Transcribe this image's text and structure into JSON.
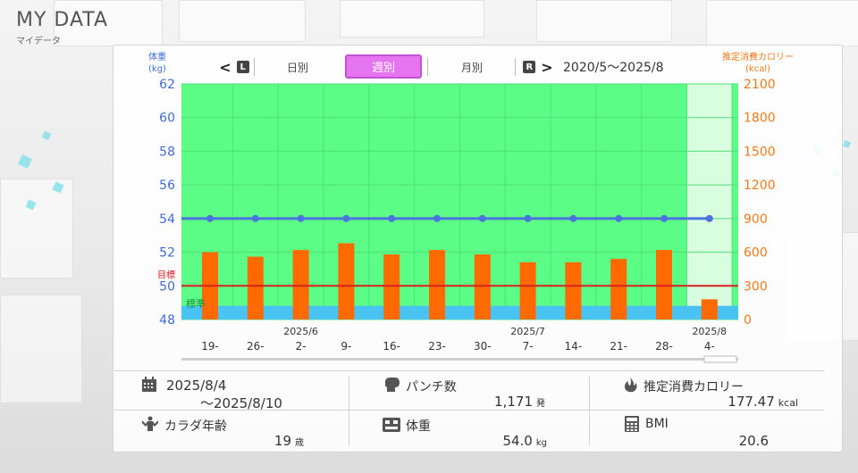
{
  "header": {
    "title": "MY DATA",
    "subtitle": "マイデータ"
  },
  "nav": {
    "prev_key": "L",
    "next_key": "R",
    "prev_arrow": "<",
    "next_arrow": ">",
    "tabs": [
      "日別",
      "週別",
      "月別"
    ],
    "selected_tab": "週別",
    "range": "2020/5〜2025/8"
  },
  "axes": {
    "left_label_1": "体重",
    "left_label_2": "(kg)",
    "right_label_1": "推定消費カロリー",
    "right_label_2": "(kcal)",
    "target_label": "目標",
    "standard_label": "標準"
  },
  "colors": {
    "plot_bg": "#5cfd87",
    "current_week_bg": "#d9fddf",
    "weight_line": "#4a74dc",
    "target_line": "#d92020",
    "calorie_bar": "#ff6a00",
    "standard_band": "#49c4f2",
    "left_axis_text": "#3f6bd6",
    "right_axis_text": "#f07a1a"
  },
  "chart_data": {
    "type": "bar",
    "x_labels": [
      "19-",
      "26-",
      "2-",
      "9-",
      "16-",
      "23-",
      "30-",
      "7-",
      "14-",
      "21-",
      "28-",
      "4-"
    ],
    "month_labels": [
      {
        "at_index": 2,
        "label": "2025/6"
      },
      {
        "at_index": 7,
        "label": "2025/7"
      },
      {
        "at_index": 11,
        "label": "2025/8"
      }
    ],
    "series": [
      {
        "name": "推定消費カロリー",
        "axis": "right",
        "type": "bar",
        "values": [
          600,
          560,
          620,
          680,
          580,
          620,
          580,
          510,
          510,
          540,
          620,
          180
        ]
      },
      {
        "name": "体重",
        "axis": "left",
        "type": "line",
        "values": [
          54,
          54,
          54,
          54,
          54,
          54,
          54,
          54,
          54,
          54,
          54,
          54
        ]
      }
    ],
    "target_weight": 50,
    "standard_band": [
      48,
      48.6
    ],
    "left_axis": {
      "ylim": [
        48,
        62
      ],
      "ticks": [
        48,
        50,
        52,
        54,
        56,
        58,
        60,
        62
      ]
    },
    "right_axis": {
      "ylim": [
        0,
        2100
      ],
      "ticks": [
        0,
        300,
        600,
        900,
        1200,
        1500,
        1800,
        2100
      ]
    },
    "current_week_index": 11
  },
  "stats": {
    "period_start": "2025/8/4",
    "period_end": "〜2025/8/10",
    "punch_label": "パンチ数",
    "punch_value": "1,171",
    "punch_unit": "発",
    "calorie_label": "推定消費カロリー",
    "calorie_value": "177.47",
    "calorie_unit": "kcal",
    "body_age_label": "カラダ年齢",
    "body_age_value": "19",
    "body_age_unit": "歳",
    "weight_label": "体重",
    "weight_value": "54.0",
    "weight_unit": "kg",
    "bmi_label": "BMI",
    "bmi_value": "20.6"
  }
}
